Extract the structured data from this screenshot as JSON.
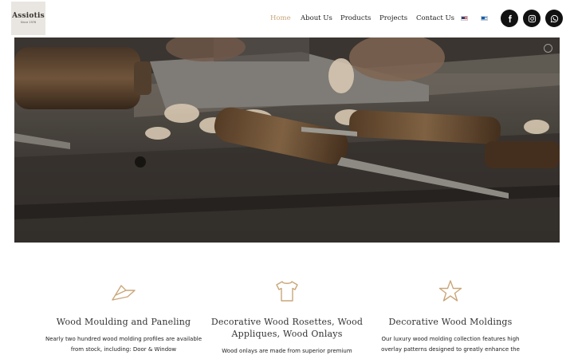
{
  "header": {
    "logo": {
      "name": "Assiotis",
      "sub": "Since 1976"
    },
    "nav": [
      {
        "label": "Home",
        "active": true
      },
      {
        "label": "About Us",
        "active": false
      },
      {
        "label": "Products",
        "active": false
      },
      {
        "label": "Projects",
        "active": false
      },
      {
        "label": "Contact Us",
        "active": false
      }
    ],
    "languages": [
      "en-flag-icon",
      "gr-flag-icon"
    ],
    "social": [
      "facebook-icon",
      "instagram-icon",
      "whatsapp-icon"
    ],
    "accent_color": "#c9a77a"
  },
  "hero": {
    "image": "woodworking-tools-photo",
    "slider_dots": 1
  },
  "features": [
    {
      "icon": "wood-plane-icon",
      "title": "Wood Moulding and Paneling",
      "text": "Nearly two hundred wood molding profiles are available from stock, including: Door & Window"
    },
    {
      "icon": "tshirt-icon",
      "title": "Decorative Wood Rosettes, Wood Appliques, Wood Onlays",
      "text": "Wood onlays are made from superior premium"
    },
    {
      "icon": "star-icon",
      "title": "Decorative Wood Moldings",
      "text": "Our luxury wood molding collection features high overlay patterns designed to greatly enhance the"
    }
  ]
}
